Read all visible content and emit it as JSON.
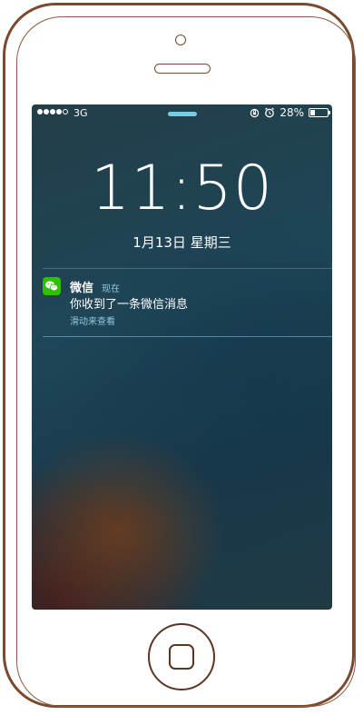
{
  "status_bar": {
    "signal_bars_filled": 4,
    "signal_bars_total": 5,
    "carrier": "3G",
    "battery_percent": "28%",
    "battery_level": 0.28,
    "icons": [
      "orientation-lock-icon",
      "alarm-icon"
    ]
  },
  "lock_screen": {
    "time": "11:50",
    "date": "1月13日 星期三"
  },
  "notification": {
    "app_icon": "wechat-icon",
    "app_name": "微信",
    "time": "现在",
    "message": "你收到了一条微信消息",
    "action": "滑动来查看"
  },
  "colors": {
    "accent": "#6ecfe6",
    "wechat_green": "#2ec100",
    "frame_stroke": "#7a4a2e"
  }
}
